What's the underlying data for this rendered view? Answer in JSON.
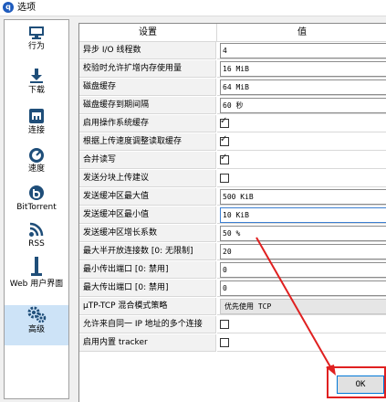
{
  "window": {
    "title": "选项",
    "icon": "app-logo-icon"
  },
  "sidebar": {
    "items": [
      {
        "label": "行为",
        "icon": "monitor-icon"
      },
      {
        "label": "下载",
        "icon": "download-icon"
      },
      {
        "label": "连接",
        "icon": "network-port-icon"
      },
      {
        "label": "速度",
        "icon": "speedometer-icon"
      },
      {
        "label": "BitTorrent",
        "icon": "bittorrent-icon"
      },
      {
        "label": "RSS",
        "icon": "rss-icon"
      },
      {
        "label": "Web 用户界面",
        "icon": "web-ui-icon"
      },
      {
        "label": "高级",
        "icon": "gears-icon",
        "selected": true
      }
    ]
  },
  "table": {
    "headers": [
      "设置",
      "值"
    ],
    "rows": [
      {
        "label": "异步 I/O 线程数",
        "type": "text",
        "value": "4"
      },
      {
        "label": "校验时允许扩增内存使用量",
        "type": "text",
        "value": "16 MiB"
      },
      {
        "label": "磁盘缓存",
        "type": "text",
        "value": "64 MiB"
      },
      {
        "label": "磁盘缓存到期间隔",
        "type": "text",
        "value": "60 秒"
      },
      {
        "label": "启用操作系统缓存",
        "type": "checkbox",
        "checked": true
      },
      {
        "label": "根据上传速度调整读取缓存",
        "type": "checkbox",
        "checked": true
      },
      {
        "label": "合并读写",
        "type": "checkbox",
        "checked": true
      },
      {
        "label": "发送分块上传建议",
        "type": "checkbox",
        "checked": false
      },
      {
        "label": "发送缓冲区最大值",
        "type": "text",
        "value": "500 KiB"
      },
      {
        "label": "发送缓冲区最小值",
        "type": "text",
        "value": "10 KiB",
        "active": true
      },
      {
        "label": "发送缓冲区增长系数",
        "type": "text",
        "value": "50 %"
      },
      {
        "label": "最大半开放连接数 [0: 无限制]",
        "type": "text",
        "value": "20"
      },
      {
        "label": "最小传出端口 [0: 禁用]",
        "type": "text",
        "value": "0"
      },
      {
        "label": "最大传出端口 [0: 禁用]",
        "type": "text",
        "value": "0"
      },
      {
        "label": "μTP-TCP 混合模式策略",
        "type": "combo",
        "value": "优先使用 TCP"
      },
      {
        "label": "允许来自同一 IP 地址的多个连接",
        "type": "checkbox",
        "checked": false
      },
      {
        "label": "启用内置 tracker",
        "type": "checkbox",
        "checked": false
      }
    ]
  },
  "buttons": {
    "ok": "OK"
  },
  "annotation": {
    "color": "#e02020"
  }
}
